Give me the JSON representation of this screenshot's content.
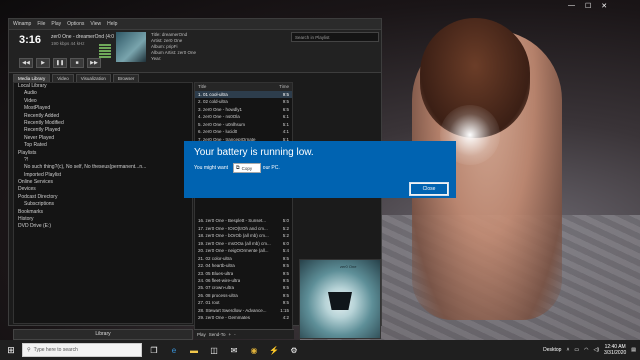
{
  "window_controls": {
    "minimize": "—",
    "maximize": "☐",
    "close": "✕"
  },
  "winamp": {
    "menu": [
      "Winamp",
      "File",
      "Play",
      "Options",
      "View",
      "Help"
    ],
    "player": {
      "time": "3:16",
      "song": "zer0 One - dreamerOnd (4:0",
      "bitrate": "190 kbps 44 kHz",
      "meta": [
        "Title: dreamerOnd",
        "Artist: zer0 One",
        "Album: pripFi",
        "Album Artist: zer0 One",
        "Year:"
      ],
      "controls": [
        "◀◀",
        "▶",
        "❚❚",
        "■",
        "▶▶"
      ]
    },
    "search_placeholder": "Search in Playlist",
    "tabs": [
      "Media Library",
      "Video",
      "Visualization",
      "Browser"
    ],
    "tree": [
      {
        "label": "Local Library",
        "level": 0
      },
      {
        "label": "Audio",
        "level": 1
      },
      {
        "label": "Video",
        "level": 1
      },
      {
        "label": "MostPlayed",
        "level": 1
      },
      {
        "label": "Recently Added",
        "level": 1
      },
      {
        "label": "Recently Modified",
        "level": 1
      },
      {
        "label": "Recently Played",
        "level": 1
      },
      {
        "label": "Never Played",
        "level": 1
      },
      {
        "label": "Top Rated",
        "level": 1
      },
      {
        "label": "Playlists",
        "level": 0
      },
      {
        "label": "?!",
        "level": 1
      },
      {
        "label": "No such thing?(c), No self, No theseus(permanent...n...",
        "level": 1
      },
      {
        "label": "Imported Playlist",
        "level": 1
      },
      {
        "label": "Online Services",
        "level": 0
      },
      {
        "label": "Devices",
        "level": 0
      },
      {
        "label": "Podcast Directory",
        "level": 0
      },
      {
        "label": "Subscriptions",
        "level": 1
      },
      {
        "label": "Bookmarks",
        "level": 0
      },
      {
        "label": "History",
        "level": 0
      },
      {
        "label": "DVD Drive (E:)",
        "level": 0
      }
    ],
    "library_button": "Library",
    "playlist": {
      "header": {
        "title": "Title",
        "time": "Time"
      },
      "rows": [
        {
          "t": "1. 01 cool-ultra",
          "d": "9:5"
        },
        {
          "t": "2. 02 cold-ultra",
          "d": "9:5"
        },
        {
          "t": "3. zer0 One - howdly1",
          "d": "6:5"
        },
        {
          "t": "4. zer0 One - ns0Ola",
          "d": "6:1"
        },
        {
          "t": "5. zer0 One - u0nlhsum",
          "d": "5:1"
        },
        {
          "t": "6. zer0 One - lucid0",
          "d": "4:1"
        },
        {
          "t": "7. zer0 One - trancepIOrnate",
          "d": "5:1"
        },
        {
          "t": "",
          "d": ""
        },
        {
          "t": "",
          "d": ""
        },
        {
          "t": "",
          "d": ""
        },
        {
          "t": "",
          "d": ""
        },
        {
          "t": "",
          "d": ""
        },
        {
          "t": "",
          "d": ""
        },
        {
          "t": "",
          "d": ""
        },
        {
          "t": "",
          "d": ""
        },
        {
          "t": "",
          "d": ""
        },
        {
          "t": "",
          "d": ""
        },
        {
          "t": "16. zer0 One - Besplett - Sunset...",
          "d": "5:0"
        },
        {
          "t": "17. zer0 One - tOrO(trOh and cm...",
          "d": "5:2"
        },
        {
          "t": "18. zer0 One - bOrOb (all mb) cm...",
          "d": "5:2"
        },
        {
          "t": "19. zer0 One - msOOa (all mb) cm...",
          "d": "6:0"
        },
        {
          "t": "20. zer0 One - neigOOrmente (all...",
          "d": "5:4"
        },
        {
          "t": "21. 02 color-ultra",
          "d": "9:5"
        },
        {
          "t": "22. 04 heartb-ultra",
          "d": "9:5"
        },
        {
          "t": "23. 05 Blues-ultra",
          "d": "9:5"
        },
        {
          "t": "24. 06 fleet-wire-ultra",
          "d": "9:5"
        },
        {
          "t": "25. 07 crown-ultra",
          "d": "9:5"
        },
        {
          "t": "26. 08 process-ultra",
          "d": "9:5"
        },
        {
          "t": "27. 01 root",
          "d": "9:5"
        },
        {
          "t": "28. Stewart Swerdlow - Advance...",
          "d": "1:15"
        },
        {
          "t": "29. zer0 One - Gemmates",
          "d": "4:2"
        }
      ],
      "footer": [
        "Play",
        "Send-To",
        "+",
        "-"
      ]
    },
    "art_label": "zer0 One"
  },
  "dialog": {
    "title": "Your battery is running low.",
    "body_prefix": "You might want",
    "body_suffix": "our PC.",
    "copy_tooltip": "Copy",
    "close_label": "Close"
  },
  "taskbar": {
    "search_placeholder": "Type here to search",
    "icons": [
      "task-view",
      "edge",
      "file-explorer",
      "store",
      "mail",
      "chrome",
      "winamp",
      "settings"
    ],
    "desktop_label": "Desktop",
    "time": "12:40 AM",
    "date": "3/31/2020"
  }
}
